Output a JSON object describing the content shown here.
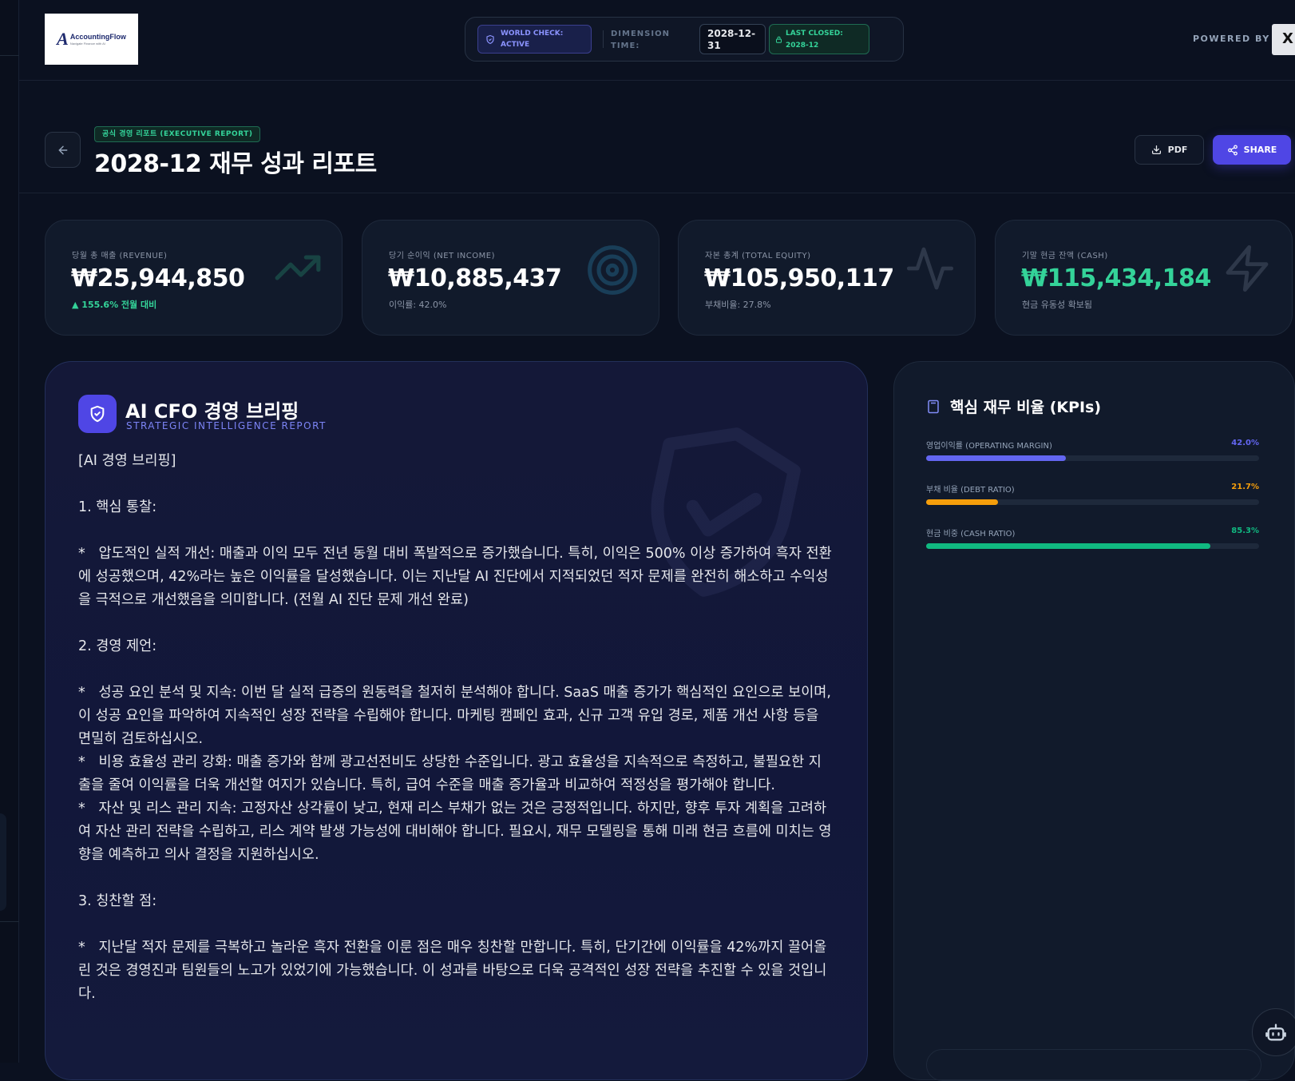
{
  "header": {
    "logo_alt": "AccountingFlow",
    "logo_name": "AccountingFlow",
    "logo_tagline": "Navigate Finance with AI",
    "world_check": "WORLD CHECK: ACTIVE",
    "dimension_label": "DIMENSION TIME:",
    "dimension_value": "2028-12-31",
    "last_closed": "LAST CLOSED: 2028-12",
    "powered_by": "POWERED BY"
  },
  "title_row": {
    "badge": "공식 경영 리포트 (EXECUTIVE REPORT)",
    "title": "2028-12 재무 성과 리포트",
    "pdf_label": "PDF",
    "share_label": "SHARE"
  },
  "kpis": [
    {
      "label": "당월 총 매출 (REVENUE)",
      "value": "₩25,944,850",
      "sub": "▲ 155.6% 전월 대비",
      "icon": "trending-up-icon"
    },
    {
      "label": "당기 순이익 (NET INCOME)",
      "value": "₩10,885,437",
      "sub": "이익률: 42.0%",
      "icon": "target-icon"
    },
    {
      "label": "자본 총계 (TOTAL EQUITY)",
      "value": "₩105,950,117",
      "sub": "부채비율: 27.8%",
      "icon": "activity-icon"
    },
    {
      "label": "기말 현금 잔액 (CASH)",
      "value": "₩115,434,184",
      "sub": "현금 유동성 확보됨",
      "icon": "zap-icon"
    }
  ],
  "briefing": {
    "title": "AI CFO 경영 브리핑",
    "subtitle": "STRATEGIC INTELLIGENCE REPORT",
    "body": "[AI 경영 브리핑]\n\n1. 핵심 통찰:\n\n*   압도적인 실적 개선: 매출과 이익 모두 전년 동월 대비 폭발적으로 증가했습니다. 특히, 이익은 500% 이상 증가하여 흑자 전환에 성공했으며, 42%라는 높은 이익률을 달성했습니다. 이는 지난달 AI 진단에서 지적되었던 적자 문제를 완전히 해소하고 수익성을 극적으로 개선했음을 의미합니다. (전월 AI 진단 문제 개선 완료)\n\n2. 경영 제언:\n\n*   성공 요인 분석 및 지속: 이번 달 실적 급증의 원동력을 철저히 분석해야 합니다. SaaS 매출 증가가 핵심적인 요인으로 보이며, 이 성공 요인을 파악하여 지속적인 성장 전략을 수립해야 합니다. 마케팅 캠페인 효과, 신규 고객 유입 경로, 제품 개선 사항 등을 면밀히 검토하십시오.\n*   비용 효율성 관리 강화: 매출 증가와 함께 광고선전비도 상당한 수준입니다. 광고 효율성을 지속적으로 측정하고, 불필요한 지출을 줄여 이익률을 더욱 개선할 여지가 있습니다. 특히, 급여 수준을 매출 증가율과 비교하여 적정성을 평가해야 합니다.\n*   자산 및 리스 관리 지속: 고정자산 상각률이 낮고, 현재 리스 부채가 없는 것은 긍정적입니다. 하지만, 향후 투자 계획을 고려하여 자산 관리 전략을 수립하고, 리스 계약 발생 가능성에 대비해야 합니다. 필요시, 재무 모델링을 통해 미래 현금 흐름에 미치는 영향을 예측하고 의사 결정을 지원하십시오.\n\n3. 칭찬할 점:\n\n*   지난달 적자 문제를 극복하고 놀라운 흑자 전환을 이룬 점은 매우 칭찬할 만합니다. 특히, 단기간에 이익률을 42%까지 끌어올린 것은 경영진과 팀원들의 노고가 있었기에 가능했습니다. 이 성과를 바탕으로 더욱 공격적인 성장 전략을 추진할 수 있을 것입니다."
  },
  "ratios": {
    "title": "핵심 재무 비율 (KPIs)",
    "items": [
      {
        "label": "영업이익률 (OPERATING MARGIN)",
        "value": "42.0%",
        "fraction": 0.42,
        "color": "#6366f1"
      },
      {
        "label": "부채 비율 (DEBT RATIO)",
        "value": "21.7%",
        "fraction": 0.217,
        "color": "#f59e0b"
      },
      {
        "label": "현금 비중 (CASH RATIO)",
        "value": "85.3%",
        "fraction": 0.853,
        "color": "#10b981"
      }
    ]
  },
  "colors": {
    "accent": "#4f46e5",
    "positive": "#34d399",
    "warning": "#f59e0b",
    "background": "#0b1120"
  }
}
